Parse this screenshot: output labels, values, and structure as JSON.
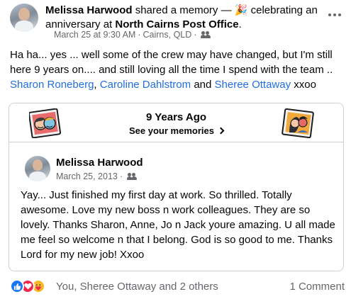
{
  "header": {
    "author": "Melissa Harwood",
    "action": " shared a memory — 🎉 celebrating an anniversary at ",
    "place": "North Cairns Post Office",
    "place_suffix": ".",
    "meta_time": "March 25 at 9:30 AM",
    "meta_location": "Cairns, QLD",
    "separator": "·",
    "audience_icon": "people-icon",
    "more_icon": "more-options-icon"
  },
  "post": {
    "text_1": "Ha ha... yes ... well some of the crew may have changed,  but I'm still here 9 years on.... and still loving all the time I spend with the team .. ",
    "tag_1": "Sharon Roneberg",
    "sep_1": ", ",
    "tag_2": "Caroline Dahlstrom",
    "sep_2": "  and ",
    "tag_3": "Sheree Ottaway",
    "text_end": "  xxoo"
  },
  "memory": {
    "title": "9 Years Ago",
    "link": "See your memories",
    "left_art_icon": "friends-memory-illustration",
    "right_art_icon": "couple-memory-illustration",
    "original": {
      "author": "Melissa Harwood",
      "date": "March 25, 2013",
      "separator": "·",
      "text": "Yay... Just finished my first day at work. So thrilled. Totally awesome. Love my new boss n work colleagues. They are so lovely. Thanks Sharon, Anne, Jo n Jack youre amazing. U all made me feel so welcome n that I belong. God is so good to me. Thanks Lord for my new job! Xxoo"
    }
  },
  "footer": {
    "reactions": [
      "like",
      "love",
      "care"
    ],
    "reactors": "You, Sheree Ottaway and 2 others",
    "comments": "1 Comment"
  },
  "colors": {
    "link": "#216fdb",
    "secondary_text": "#65676b",
    "like": "#1877f2",
    "love": "#f02849",
    "care": "#f7b928"
  }
}
